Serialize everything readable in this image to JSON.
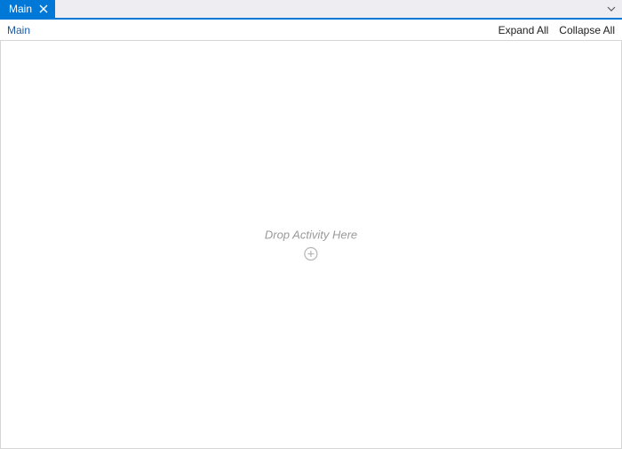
{
  "tabs": {
    "active": {
      "label": "Main"
    }
  },
  "toolbar": {
    "breadcrumb": "Main",
    "expand_all_label": "Expand All",
    "collapse_all_label": "Collapse All"
  },
  "canvas": {
    "drop_hint": "Drop Activity Here"
  },
  "icons": {
    "close": "close-icon",
    "overflow": "chevron-down-icon",
    "add": "plus-circle-icon"
  },
  "colors": {
    "accent": "#0078d7",
    "tabstrip_bg": "#eeeef2",
    "border": "#d6d6d6",
    "hint_text": "#9a9a9a"
  }
}
